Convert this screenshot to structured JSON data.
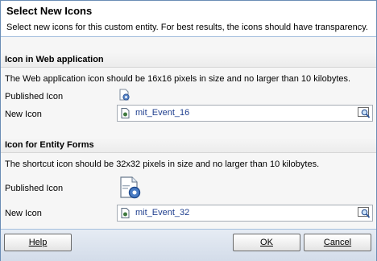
{
  "header": {
    "title": "Select New Icons",
    "description": "Select new icons for this custom entity. For best results, the icons should have transparency."
  },
  "web_section": {
    "title": "Icon in Web application",
    "description": "The Web application icon should be 16x16 pixels in size and no larger than 10 kilobytes.",
    "published_label": "Published Icon",
    "new_label": "New Icon",
    "new_value": "mit_Event_16"
  },
  "forms_section": {
    "title": "Icon for Entity Forms",
    "description": "The shortcut icon should be 32x32 pixels in size and no larger than 10 kilobytes.",
    "published_label": "Published Icon",
    "new_label": "New Icon",
    "new_value": "mit_Event_32"
  },
  "footer": {
    "help_label": "Help",
    "ok_label": "OK",
    "cancel_label": "Cancel"
  },
  "icons": {
    "published_small": "gear-document-icon",
    "published_large": "gear-document-icon",
    "file": "web-resource-file-icon",
    "lookup": "lookup-search-icon"
  },
  "colors": {
    "accent_border": "#6b8db5",
    "link_text": "#1f3f8f",
    "footer_bg": "#d3dce9"
  }
}
